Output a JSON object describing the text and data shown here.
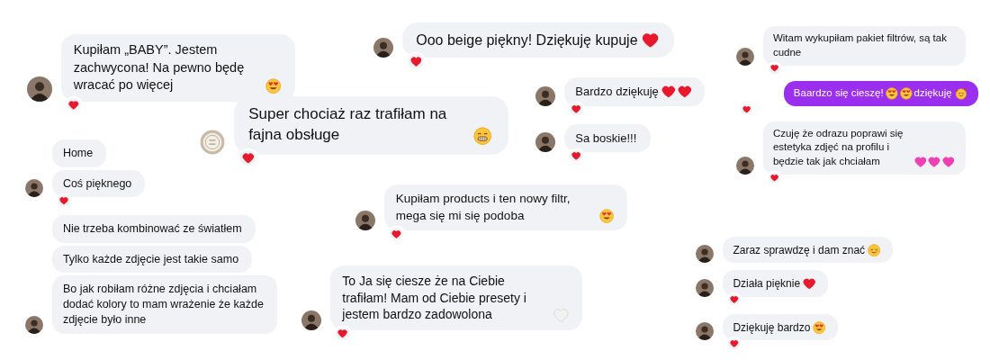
{
  "groups": [
    {
      "messages": [
        {
          "parts": [
            {
              "kind": "text",
              "text": "Kupiłam „BABY”. Jestem zachwycona! Na pewno będę wracać po więcej"
            },
            {
              "kind": "heart-eyes"
            }
          ],
          "avatar": {
            "kind": "photo"
          },
          "reaction": true,
          "outgoing": false
        }
      ]
    },
    {
      "messages": [
        {
          "parts": [
            {
              "kind": "text",
              "text": "Super chociaż raz trafiłam na fajna obsługe"
            },
            {
              "kind": "grin"
            }
          ],
          "avatar": {
            "kind": "logo"
          },
          "reaction": true,
          "outgoing": false
        }
      ]
    },
    {
      "messages": [
        {
          "parts": [
            {
              "kind": "text",
              "text": "Home"
            }
          ],
          "reaction": false,
          "outgoing": false
        },
        {
          "parts": [
            {
              "kind": "text",
              "text": "Coś pięknego"
            }
          ],
          "avatar": {
            "kind": "photo"
          },
          "reaction": true,
          "outgoing": false
        }
      ]
    },
    {
      "messages": [
        {
          "parts": [
            {
              "kind": "text",
              "text": "Nie trzeba kombinować ze światłem"
            }
          ],
          "reaction": false,
          "outgoing": false
        },
        {
          "parts": [
            {
              "kind": "text",
              "text": "Tylko każde zdjęcie jest takie samo"
            }
          ],
          "reaction": false,
          "outgoing": false
        },
        {
          "parts": [
            {
              "kind": "text",
              "text": "Bo jak robiłam różne zdjęcia i chciałam dodać kolory to mam wrażenie że każde zdjęcie było inne"
            }
          ],
          "avatar": {
            "kind": "photo"
          },
          "reaction": false,
          "outgoing": false
        }
      ]
    },
    {
      "messages": [
        {
          "parts": [
            {
              "kind": "text",
              "text": "Ooo beige piękny! Dziękuję kupuje"
            },
            {
              "kind": "heart"
            }
          ],
          "avatar": {
            "kind": "photo"
          },
          "reaction": true,
          "outgoing": false
        }
      ]
    },
    {
      "messages": [
        {
          "parts": [
            {
              "kind": "text",
              "text": "Bardzo dziękuję"
            },
            {
              "kind": "heart"
            },
            {
              "kind": "heart"
            }
          ],
          "avatar": {
            "kind": "photo"
          },
          "reaction": true,
          "outgoing": false
        },
        {
          "parts": [
            {
              "kind": "text",
              "text": "Sa boskie!!!"
            }
          ],
          "avatar": {
            "kind": "photo"
          },
          "reaction": true,
          "outgoing": false
        }
      ]
    },
    {
      "messages": [
        {
          "parts": [
            {
              "kind": "text",
              "text": "Kupiłam products i ten nowy filtr, mega się mi się podoba"
            },
            {
              "kind": "heart-eyes"
            }
          ],
          "avatar": {
            "kind": "photo"
          },
          "reaction": true,
          "outgoing": false
        }
      ]
    },
    {
      "messages": [
        {
          "parts": [
            {
              "kind": "text",
              "text": "To Ja się ciesze że na Ciebie trafiłam! Mam od Ciebie presety i jestem bardzo zadowolona"
            },
            {
              "kind": "white-heart"
            }
          ],
          "avatar": {
            "kind": "photo"
          },
          "reaction": true,
          "outgoing": false
        }
      ]
    },
    {
      "messages": [
        {
          "parts": [
            {
              "kind": "text",
              "text": "Witam wykupiłam pakiet filtrów, są tak cudne"
            }
          ],
          "avatar": {
            "kind": "photo"
          },
          "reaction": true,
          "outgoing": false
        },
        {
          "parts": [
            {
              "kind": "text",
              "text": "Baardzo się cieszę!"
            },
            {
              "kind": "heart-eyes"
            },
            {
              "kind": "heart-eyes"
            },
            {
              "kind": "text",
              "text": "dziękuję"
            },
            {
              "kind": "hearts-face"
            }
          ],
          "reaction": true,
          "outgoing": true
        },
        {
          "parts": [
            {
              "kind": "text",
              "text": "Czuję że odrazu poprawi się estetyka zdjęć na profilu i będzie tak jak chciałam"
            },
            {
              "kind": "pink-heart"
            },
            {
              "kind": "pink-heart"
            },
            {
              "kind": "pink-heart"
            }
          ],
          "avatar": {
            "kind": "photo"
          },
          "reaction": true,
          "outgoing": false
        }
      ]
    },
    {
      "messages": [
        {
          "parts": [
            {
              "kind": "text",
              "text": "Zaraz sprawdzę i dam znać"
            },
            {
              "kind": "smile"
            }
          ],
          "avatar": {
            "kind": "photo"
          },
          "reaction": false,
          "outgoing": false
        },
        {
          "parts": [
            {
              "kind": "text",
              "text": "Działa pięknie"
            },
            {
              "kind": "heart"
            }
          ],
          "avatar": {
            "kind": "photo"
          },
          "reaction": true,
          "outgoing": false
        },
        {
          "parts": [
            {
              "kind": "text",
              "text": "Dziękuję bardzo"
            },
            {
              "kind": "heart-eyes"
            }
          ],
          "avatar": {
            "kind": "photo"
          },
          "reaction": true,
          "outgoing": false
        }
      ]
    }
  ]
}
